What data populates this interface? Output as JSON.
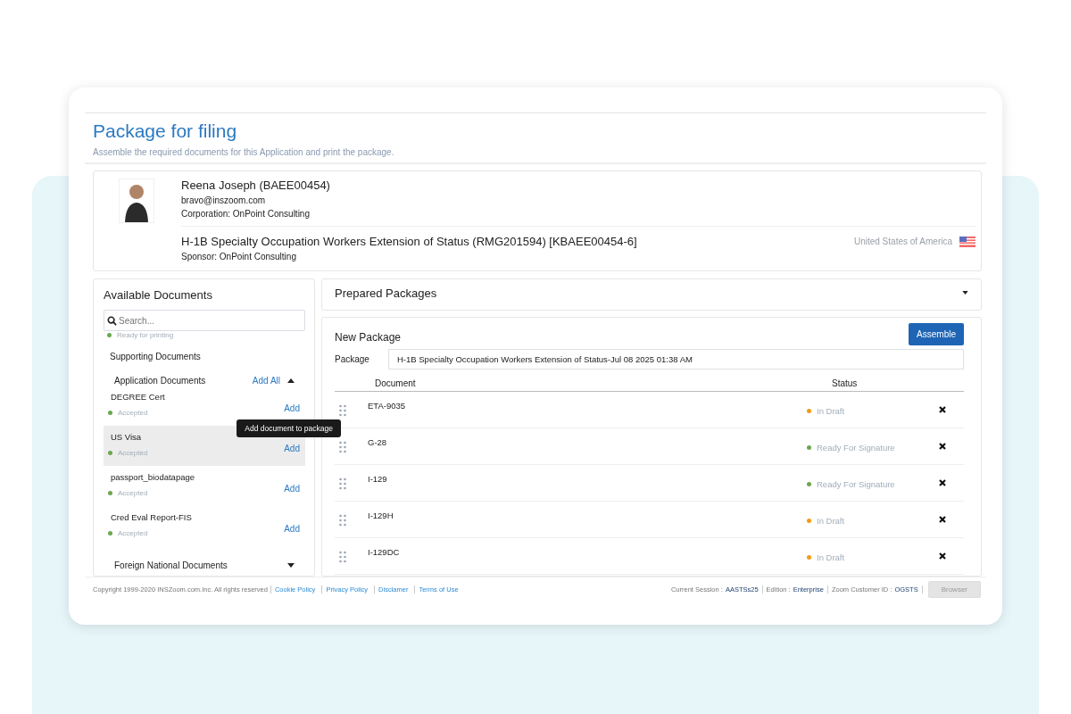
{
  "page": {
    "title": "Package for filing",
    "subtitle": "Assemble the required documents for this Application and print the package."
  },
  "applicant": {
    "name": "Reena Joseph (BAEE00454)",
    "email": "bravo@inszoom.com",
    "corporation": "Corporation: OnPoint Consulting",
    "case_title": "H-1B Specialty Occupation Workers Extension of Status (RMG201594) [KBAEE00454-6]",
    "sponsor": "Sponsor: OnPoint Consulting",
    "country": "United States of America"
  },
  "available_documents": {
    "title": "Available Documents",
    "search": {
      "placeholder": "Search..."
    },
    "top_status": {
      "label": "Ready for printing",
      "color": "#6aa84f"
    },
    "sections": [
      {
        "title": "Supporting Documents",
        "kind": "heading"
      },
      {
        "title": "Application Documents",
        "kind": "group",
        "add_all": "Add All",
        "expanded": true,
        "documents": [
          {
            "name": "DEGREE Cert",
            "status": "Accepted",
            "color": "#6aa84f",
            "action": "Add",
            "selected": false
          },
          {
            "name": "US Visa",
            "status": "Accepted",
            "color": "#6aa84f",
            "action": "Add",
            "selected": true,
            "tooltip": "Add document to package"
          },
          {
            "name": "passport_biodatapage",
            "status": "Accepted",
            "color": "#6aa84f",
            "action": "Add",
            "selected": false
          },
          {
            "name": "Cred Eval Report-FIS",
            "status": "Accepted",
            "color": "#6aa84f",
            "action": "Add",
            "selected": false
          }
        ]
      },
      {
        "title": "Foreign National Documents",
        "kind": "group",
        "expanded": false
      }
    ]
  },
  "prepared_packages": {
    "title": "Prepared Packages",
    "expanded": false
  },
  "new_package": {
    "title": "New Package",
    "assemble_button": "Assemble",
    "package_label": "Package",
    "package_value": "H-1B  Specialty Occupation Workers Extension of Status-Jul 08 2025 01:38 AM",
    "columns": [
      "Document",
      "Status"
    ],
    "rows": [
      {
        "document": "ETA-9035",
        "status": "In Draft",
        "color": "#f39c12"
      },
      {
        "document": "G-28",
        "status": "Ready For Signature",
        "color": "#6aa84f"
      },
      {
        "document": "I-129",
        "status": "Ready For Signature",
        "color": "#6aa84f"
      },
      {
        "document": "I-129H",
        "status": "In Draft",
        "color": "#f39c12"
      },
      {
        "document": "I-129DC",
        "status": "In Draft",
        "color": "#f39c12"
      }
    ]
  },
  "footer": {
    "copyright": "Copyright 1999-2020 INSZoom.com.Inc. All rights reserved",
    "links": [
      "Cookie Policy",
      "Privacy Policy",
      "Disclamer",
      "Terms of Use"
    ],
    "info": [
      {
        "label": "Current Session :",
        "value": "AASTSs25"
      },
      {
        "label": "Edition :",
        "value": "Enterprise"
      },
      {
        "label": "Zoom Customer ID :",
        "value": "OGSTS"
      }
    ],
    "browser_button": "Browser"
  }
}
